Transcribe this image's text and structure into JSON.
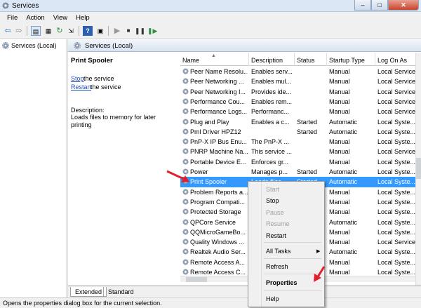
{
  "window": {
    "title": "Services",
    "controls": [
      "–",
      "□",
      "✕"
    ]
  },
  "menu": [
    "File",
    "Action",
    "View",
    "Help"
  ],
  "left_pane": {
    "item": "Services (Local)"
  },
  "pane_header": "Services (Local)",
  "details": {
    "service_name": "Print Spooler",
    "stop_link": "Stop",
    "stop_rest": " the service",
    "restart_link": "Restart",
    "restart_rest": " the service",
    "desc_label": "Description:",
    "desc_text": "Loads files to memory for later printing"
  },
  "columns": [
    "Name",
    "Description",
    "Status",
    "Startup Type",
    "Log On As"
  ],
  "rows": [
    {
      "name": "Peer Name Resolu...",
      "desc": "Enables serv...",
      "status": "",
      "type": "Manual",
      "logon": "Local Service"
    },
    {
      "name": "Peer Networking ...",
      "desc": "Enables mul...",
      "status": "",
      "type": "Manual",
      "logon": "Local Service"
    },
    {
      "name": "Peer Networking I...",
      "desc": "Provides ide...",
      "status": "",
      "type": "Manual",
      "logon": "Local Service"
    },
    {
      "name": "Performance Cou...",
      "desc": "Enables rem...",
      "status": "",
      "type": "Manual",
      "logon": "Local Service"
    },
    {
      "name": "Performance Logs...",
      "desc": "Performanc...",
      "status": "",
      "type": "Manual",
      "logon": "Local Service"
    },
    {
      "name": "Plug and Play",
      "desc": "Enables a c...",
      "status": "Started",
      "type": "Automatic",
      "logon": "Local Syste..."
    },
    {
      "name": "Pml Driver HPZ12",
      "desc": "",
      "status": "Started",
      "type": "Automatic",
      "logon": "Local Syste..."
    },
    {
      "name": "PnP-X IP Bus Enu...",
      "desc": "The PnP-X ...",
      "status": "",
      "type": "Manual",
      "logon": "Local Syste..."
    },
    {
      "name": "PNRP Machine Na...",
      "desc": "This service ...",
      "status": "",
      "type": "Manual",
      "logon": "Local Service"
    },
    {
      "name": "Portable Device E...",
      "desc": "Enforces gr...",
      "status": "",
      "type": "Manual",
      "logon": "Local Syste..."
    },
    {
      "name": "Power",
      "desc": "Manages p...",
      "status": "Started",
      "type": "Automatic",
      "logon": "Local Syste..."
    },
    {
      "name": "Print Spooler",
      "desc": "Loads files ...",
      "status": "Started",
      "type": "Automatic",
      "logon": "Local Syste..."
    },
    {
      "name": "Problem Reports a...",
      "desc": "",
      "status": "",
      "type": "Manual",
      "logon": "Local Syste..."
    },
    {
      "name": "Program Compati...",
      "desc": "",
      "status": "",
      "type": "Manual",
      "logon": "Local Syste..."
    },
    {
      "name": "Protected Storage",
      "desc": "",
      "status": "",
      "type": "Manual",
      "logon": "Local Syste..."
    },
    {
      "name": "QPCore Service",
      "desc": "",
      "status": "",
      "type": "Automatic",
      "logon": "Local Syste..."
    },
    {
      "name": "QQMicroGameBo...",
      "desc": "",
      "status": "",
      "type": "Manual",
      "logon": "Local Syste..."
    },
    {
      "name": "Quality Windows ...",
      "desc": "",
      "status": "",
      "type": "Manual",
      "logon": "Local Service"
    },
    {
      "name": "Realtek Audio Ser...",
      "desc": "",
      "status": "",
      "type": "Automatic",
      "logon": "Local Syste..."
    },
    {
      "name": "Remote Access A...",
      "desc": "",
      "status": "",
      "type": "Manual",
      "logon": "Local Syste..."
    },
    {
      "name": "Remote Access C...",
      "desc": "",
      "status": "",
      "type": "Manual",
      "logon": "Local Syste..."
    }
  ],
  "selected_row_index": 11,
  "context_menu": [
    "Start",
    "Stop",
    "Pause",
    "Resume",
    "Restart",
    "All Tasks",
    "Refresh",
    "Properties",
    "Help"
  ],
  "disabled_items": [
    "Start",
    "Pause",
    "Resume"
  ],
  "tabs": [
    "Extended",
    "Standard"
  ],
  "status_text": "Opens the properties dialog box for the current selection.",
  "colors": {
    "selection": "#3399ff",
    "highlight_box": "#d9202c",
    "arrow": "#e0202c"
  }
}
